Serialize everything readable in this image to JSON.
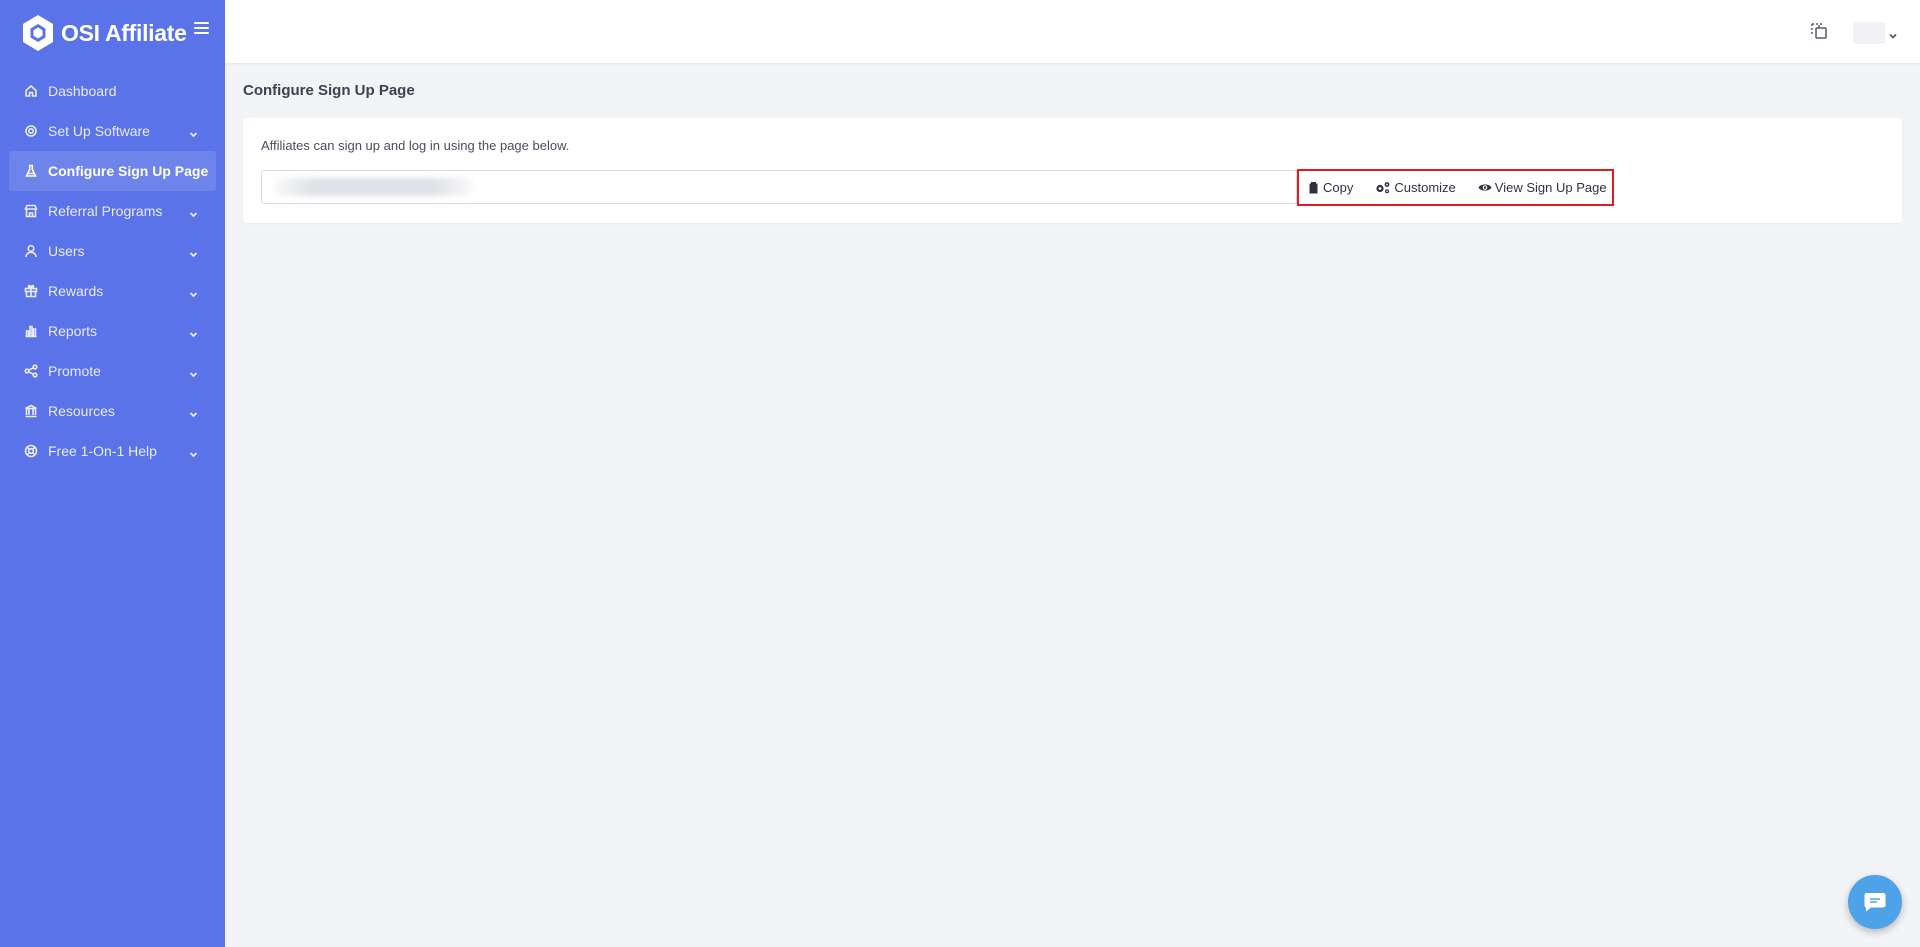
{
  "brand": {
    "name": "OSI Affiliate"
  },
  "sidebar": {
    "items": [
      {
        "label": "Dashboard",
        "icon": "home-icon",
        "has_chevron": false,
        "active": false
      },
      {
        "label": "Set Up Software",
        "icon": "gear-icon",
        "has_chevron": true,
        "active": false
      },
      {
        "label": "Configure Sign Up Page",
        "icon": "flask-icon",
        "has_chevron": false,
        "active": true
      },
      {
        "label": "Referral Programs",
        "icon": "store-icon",
        "has_chevron": true,
        "active": false
      },
      {
        "label": "Users",
        "icon": "user-icon",
        "has_chevron": true,
        "active": false
      },
      {
        "label": "Rewards",
        "icon": "gift-icon",
        "has_chevron": true,
        "active": false
      },
      {
        "label": "Reports",
        "icon": "bar-chart-icon",
        "has_chevron": true,
        "active": false
      },
      {
        "label": "Promote",
        "icon": "share-icon",
        "has_chevron": true,
        "active": false
      },
      {
        "label": "Resources",
        "icon": "bank-icon",
        "has_chevron": true,
        "active": false
      },
      {
        "label": "Free 1-On-1 Help",
        "icon": "lifebuoy-icon",
        "has_chevron": true,
        "active": false
      }
    ]
  },
  "main": {
    "page_title": "Configure Sign Up Page",
    "card": {
      "description": "Affiliates can sign up and log in using the page below.",
      "url_value": "",
      "buttons": {
        "copy": "Copy",
        "customize": "Customize",
        "view": "View Sign Up Page"
      }
    }
  },
  "colors": {
    "sidebar_bg": "#5b73e8",
    "highlight_border": "#e31b23",
    "chat_bubble": "#4ea3e8"
  }
}
